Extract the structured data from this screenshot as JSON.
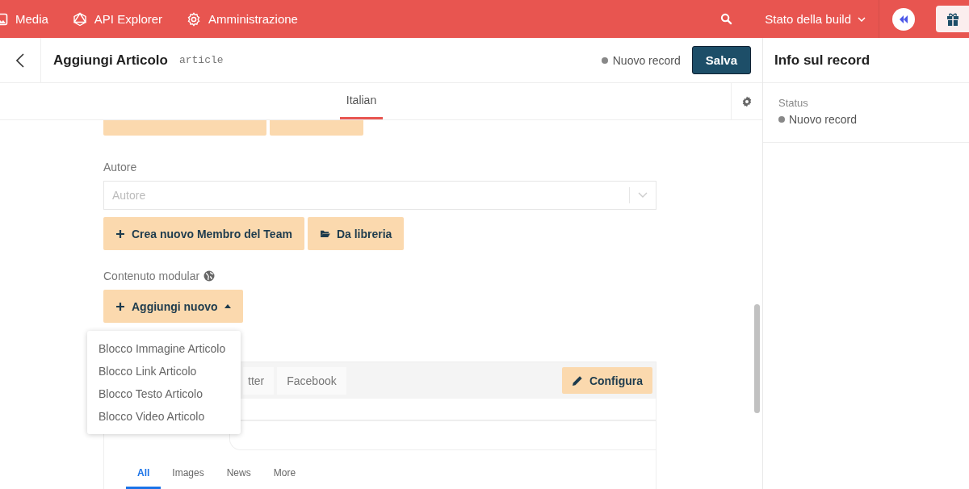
{
  "topbar": {
    "nav": [
      {
        "label": "Media"
      },
      {
        "label": "API Explorer"
      },
      {
        "label": "Amministrazione"
      }
    ],
    "build_status": "Stato della build"
  },
  "header": {
    "title": "Aggiungi Articolo",
    "api_key": "article",
    "status": "Nuovo record",
    "save": "Salva"
  },
  "locale_tabs": [
    {
      "label": "Italian",
      "selected": true
    }
  ],
  "form": {
    "author": {
      "label": "Autore",
      "placeholder": "Autore",
      "buttons": [
        "Crea nuovo Membro del Team",
        "Da libreria"
      ]
    },
    "modular": {
      "label": "Contenuto modular",
      "add": "Aggiungi nuovo",
      "menu": [
        "Blocco Immagine Articolo",
        "Blocco Link Articolo",
        "Blocco Testo Articolo",
        "Blocco Video Articolo"
      ]
    },
    "seo": {
      "tabs": [
        {
          "label": "tter",
          "selected": false
        },
        {
          "label": "Facebook",
          "selected": false
        }
      ],
      "configure": "Configura",
      "results_tabs": [
        {
          "label": "All",
          "selected": true
        },
        {
          "label": "Images",
          "selected": false
        },
        {
          "label": "News",
          "selected": false
        },
        {
          "label": "More",
          "selected": false
        }
      ]
    }
  },
  "sidebar": {
    "title": "Info sul record",
    "status_label": "Status",
    "status": "Nuovo record"
  }
}
